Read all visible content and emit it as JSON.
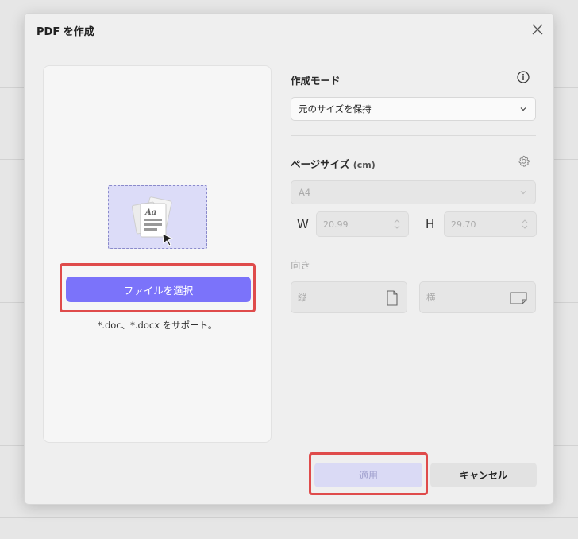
{
  "dialog": {
    "title": "PDF を作成",
    "close_icon": "close-icon"
  },
  "left": {
    "select_file_label": "ファイルを選択",
    "support_text": "*.doc、*.docx をサポート。",
    "illustration_icon": "documents-with-cursor-icon"
  },
  "right": {
    "mode_label": "作成モード",
    "mode_value": "元のサイズを保持",
    "page_size_label": "ページサイズ",
    "page_size_unit": "(cm)",
    "paper_value": "A4",
    "width_label": "W",
    "width_value": "20.99",
    "height_label": "H",
    "height_value": "29.70",
    "orientation_label": "向き",
    "portrait_label": "縦",
    "landscape_label": "横"
  },
  "footer": {
    "apply_label": "適用",
    "cancel_label": "キャンセル"
  },
  "colors": {
    "accent": "#7b73fa",
    "highlight": "#df4b4b",
    "apply_disabled_bg": "#dadaf5"
  }
}
